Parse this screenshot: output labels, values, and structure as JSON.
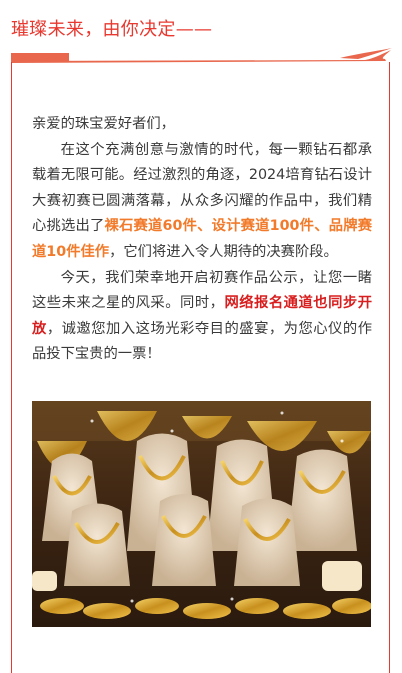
{
  "header": {
    "title": "璀璨未来，由你决定——"
  },
  "article": {
    "greeting": "亲爱的珠宝爱好者们，",
    "p1_a": "在这个充满创意与激情的时代，每一颗钻石都承载着无限可能。经过激烈的角逐，2024培育钻石设计大赛初赛已圆满落幕，从众多闪耀的作品中，我们精心挑选出了",
    "p1_highlight": "裸石赛道60件、设计赛道100件、品牌赛道10件佳作",
    "p1_b": "，它们将进入令人期待的决赛阶段。",
    "p2_a": "今天，我们荣幸地开启初赛作品公示，让您一睹这些未来之星的风采。同时，",
    "p2_highlight": "网络报名通道也同步开放",
    "p2_b": "，诚邀您加入这场光彩夺目的盛宴，为您心仪的作品投下宝贵的一票！"
  },
  "colors": {
    "accent_red": "#e8382f",
    "highlight_orange": "#f27b2b",
    "highlight_red": "#d81e1e"
  },
  "image": {
    "subject": "jewelry-display-photo"
  }
}
